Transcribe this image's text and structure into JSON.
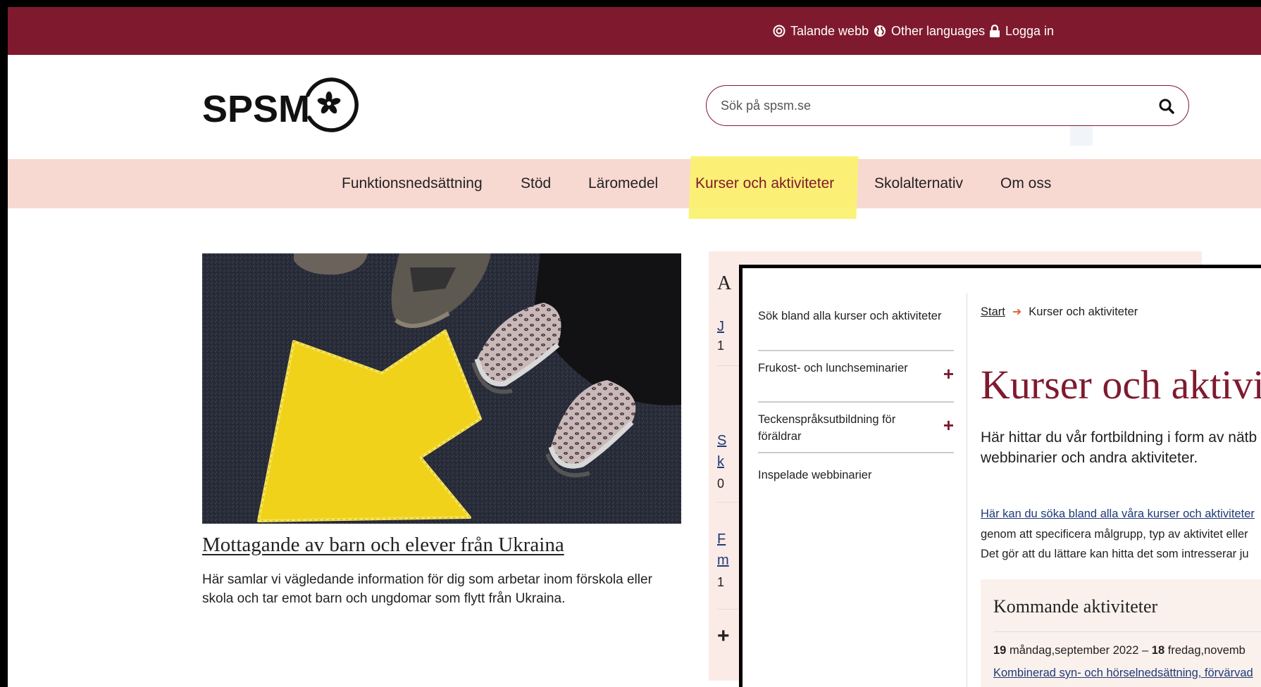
{
  "topbar": {
    "talande_webb": "Talande webb",
    "other_languages": "Other languages",
    "logga_in": "Logga in"
  },
  "header": {
    "logo_text": "SPSM",
    "search_placeholder": "Sök på spsm.se"
  },
  "nav": {
    "items": [
      {
        "label": "Funktionsnedsättning"
      },
      {
        "label": "Stöd"
      },
      {
        "label": "Läromedel"
      },
      {
        "label": "Kurser och aktiviteter",
        "highlighted": true
      },
      {
        "label": "Skolalternativ"
      },
      {
        "label": "Om oss"
      }
    ]
  },
  "hero": {
    "title": "Mottagande av barn och elever från Ukraina",
    "description": "Här samlar vi vägledande information för dig som arbetar inom förskola eller skola och tar emot barn och ungdomar som flytt från Ukraina."
  },
  "side_panel_peek": {
    "a": "A",
    "j": "J",
    "one_a": "1",
    "s": "S",
    "k": "k",
    "zero": "0",
    "f": "F",
    "m": "m",
    "one_b": "1",
    "plus": "+"
  },
  "overlay": {
    "sidebar": [
      {
        "label": "Sök bland alla kurser och aktiviteter",
        "expandable": false
      },
      {
        "label": "Frukost- och lunchseminarier",
        "expandable": true
      },
      {
        "label": "Teckenspråksutbildning för föräldrar",
        "expandable": true
      },
      {
        "label": "Inspelade webbinarier",
        "expandable": false
      }
    ],
    "breadcrumb": {
      "start": "Start",
      "current": "Kurser och aktiviteter"
    },
    "title": "Kurser och aktivit",
    "intro_line1": "Här hittar du vår fortbildning i form av nätb",
    "intro_line2": "webbinarier och andra aktiviteter.",
    "link_text": "Här kan du söka bland alla våra kurser och aktiviteter",
    "body_line2": "genom att specificera målgrupp, typ av aktivitet eller",
    "body_line3": "Det gör att du lättare kan hitta det som intresserar ju",
    "upcoming": {
      "title": "Kommande aktiviteter",
      "start_day": "19",
      "start_rest": "måndag,september 2022",
      "dash": "–",
      "end_day": "18",
      "end_rest": "fredag,novemb",
      "link": "Kombinerad syn- och hörselnedsättning, förvärvad"
    }
  },
  "colors": {
    "brand": "#7f1a2e",
    "nav_bg": "#f8d9d1",
    "highlight": "#fbf26a",
    "arrow": "#f2d51f"
  },
  "icons": [
    "target-icon",
    "globe-icon",
    "lock-icon",
    "search-icon",
    "flower-icon",
    "plus-icon",
    "arrow-right-icon"
  ]
}
